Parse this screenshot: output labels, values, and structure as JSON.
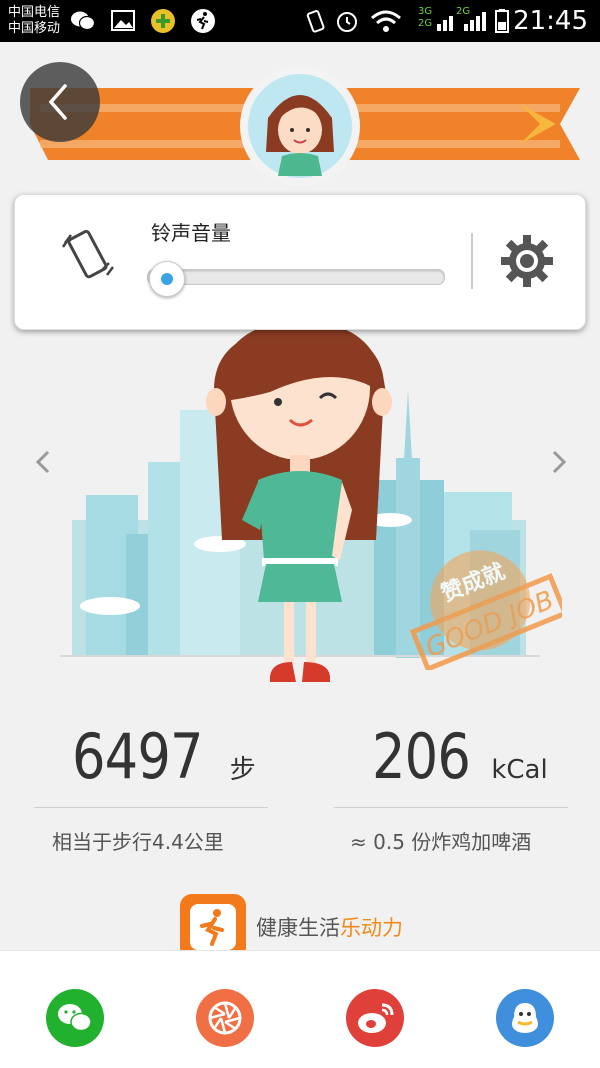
{
  "status_bar": {
    "carrier_1": "中国电信",
    "carrier_2": "中国移动",
    "network_1": "3G",
    "network_2": "2G",
    "network_3": "2G",
    "time": "21:45"
  },
  "volume_panel": {
    "title": "铃声音量",
    "level": 0.0
  },
  "stats": {
    "steps_value": "6497",
    "steps_unit": "步",
    "steps_desc": "相当于步行4.4公里",
    "kcal_value": "206",
    "kcal_unit": "kCal",
    "kcal_desc": "≈ 0.5 份炸鸡加啤酒"
  },
  "stamp": {
    "text_top": "赞成就",
    "text_bottom": "GOOD JOB"
  },
  "app": {
    "name_plain": "健康生活",
    "name_highlight": "乐动力"
  },
  "share": {
    "icons": [
      "wechat-icon",
      "moments-icon",
      "weibo-icon",
      "qq-icon"
    ]
  },
  "colors": {
    "accent_orange": "#f27a1a",
    "slider_blue": "#3aa3e3",
    "wechat_green": "#22b12e",
    "moments_orange": "#f06f45",
    "weibo_red": "#e0403a",
    "qq_blue": "#3f8fdc"
  }
}
